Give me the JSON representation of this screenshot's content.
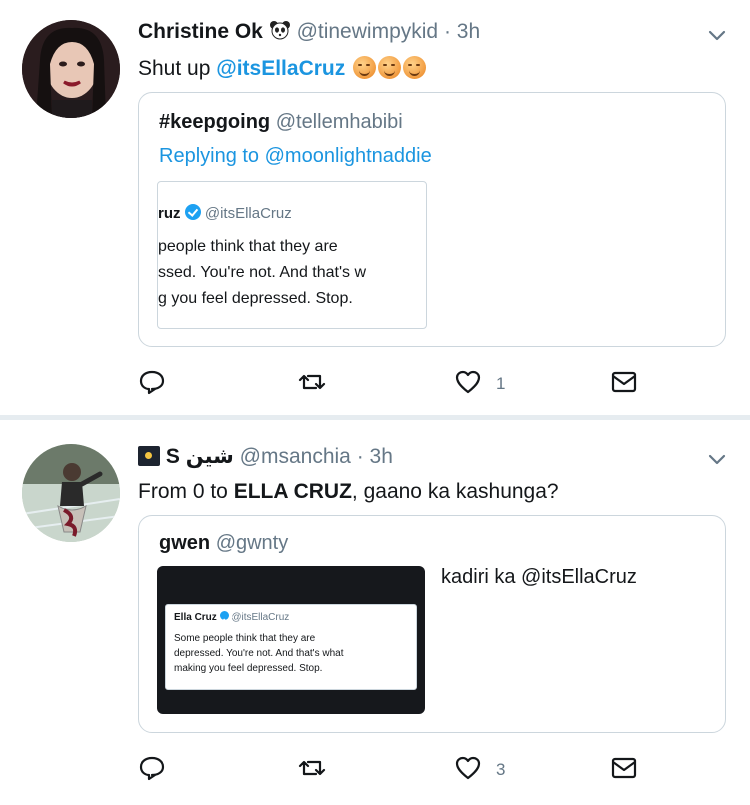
{
  "tweets": [
    {
      "name": "Christine Ok",
      "handle": "@tinewimpykid",
      "dot": "·",
      "time": "3h",
      "text_prefix": "Shut up ",
      "mention": "@itsEllaCruz",
      "quote": {
        "name": "#keepgoing",
        "handle": "@tellemhabibi",
        "reply_label": "Replying to @moonlightnaddie",
        "embedded": {
          "name": "ruz",
          "handle": "@itsEllaCruz",
          "lines": [
            "people think that they are",
            "ssed. You're not. And that's w",
            "g you feel depressed. Stop."
          ]
        }
      },
      "actions": {
        "reply_icon": "reply-icon",
        "retweet_icon": "retweet-icon",
        "like_icon": "heart-icon",
        "like_count": "1",
        "dm_icon": "message-icon"
      }
    },
    {
      "name_glyphs": "S شين",
      "handle": "@msanchia",
      "dot": "·",
      "time": "3h",
      "text_prefix": "From 0 to ",
      "text_bold": "ELLA CRUZ",
      "text_suffix": ", gaano ka kashunga?",
      "quote": {
        "name": "gwen",
        "handle": "@gwnty",
        "side_text": "kadiri ka @itsEllaCruz",
        "embedded": {
          "name": "Ella Cruz",
          "handle": "@itsEllaCruz",
          "lines": [
            "Some people think that they are",
            "depressed. You're not. And that's what",
            "making you feel depressed. Stop."
          ]
        }
      },
      "actions": {
        "reply_icon": "reply-icon",
        "retweet_icon": "retweet-icon",
        "like_icon": "heart-icon",
        "like_count": "3",
        "dm_icon": "message-icon"
      }
    }
  ],
  "colors": {
    "link": "#1b95e0",
    "muted": "#657786",
    "border": "#ccd6dd",
    "divider": "#e6ecf0"
  }
}
